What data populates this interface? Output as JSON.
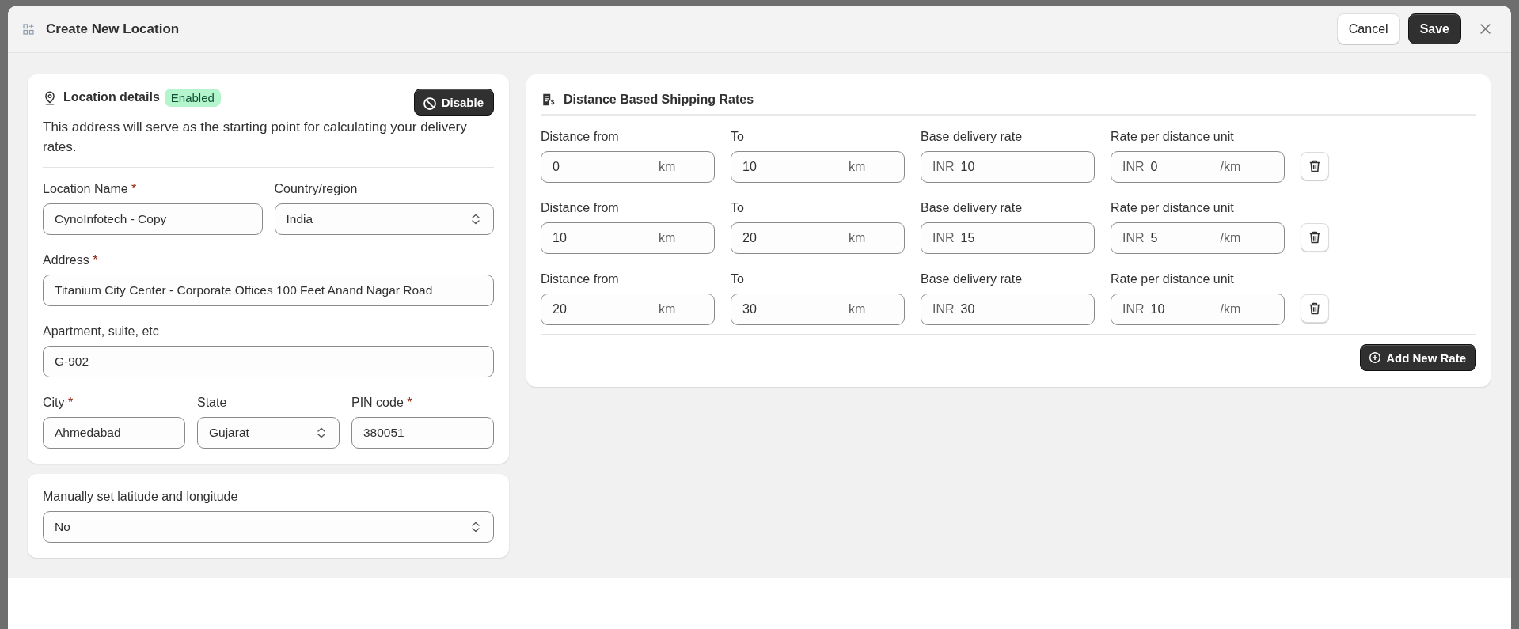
{
  "dialog": {
    "title": "Create New Location",
    "buttons": [
      {
        "label": "Cancel",
        "kind": "secondary"
      },
      {
        "label": "Save",
        "kind": "primary"
      }
    ]
  },
  "location_card": {
    "title": "Location details",
    "status_badge": "Enabled",
    "action_button": "Disable",
    "description": "This address will serve as the starting point for calculating your delivery rates.",
    "rows": [
      [
        {
          "label": "Location Name",
          "required_mark": "*",
          "value": "CynoInfotech - Copy",
          "kind": "text"
        },
        {
          "label": "Country/region",
          "value": "India",
          "kind": "select"
        }
      ],
      [
        {
          "label": "Address",
          "required_mark": "*",
          "value": "Titanium City Center - Corporate Offices 100 Feet Anand Nagar Road",
          "kind": "text"
        }
      ],
      [
        {
          "label": "Apartment, suite, etc",
          "value": "G-902",
          "kind": "text"
        }
      ],
      [
        {
          "label": "City",
          "required_mark": "*",
          "value": "Ahmedabad",
          "kind": "text"
        },
        {
          "label": "State",
          "value": "Gujarat",
          "kind": "select"
        },
        {
          "label": "PIN code",
          "required_mark": "*",
          "value": "380051",
          "kind": "text"
        }
      ]
    ]
  },
  "coordinates_card": {
    "label": "Manually set latitude and longitude",
    "value": "No",
    "kind": "select"
  },
  "shipping_card": {
    "title": "Distance Based Shipping Rates",
    "add_button": "Add New Rate",
    "rates": [
      {
        "fields": [
          {
            "label": "Distance from",
            "value": "0",
            "suffix": "km"
          },
          {
            "label": "To",
            "value": "10",
            "suffix": "km"
          },
          {
            "label": "Base delivery rate",
            "prefix": "INR",
            "value": "10"
          },
          {
            "label": "Rate per distance unit",
            "prefix": "INR",
            "value": "0",
            "suffix": "/km"
          }
        ]
      },
      {
        "fields": [
          {
            "label": "Distance from",
            "value": "10",
            "suffix": "km"
          },
          {
            "label": "To",
            "value": "20",
            "suffix": "km"
          },
          {
            "label": "Base delivery rate",
            "prefix": "INR",
            "value": "15"
          },
          {
            "label": "Rate per distance unit",
            "prefix": "INR",
            "value": "5",
            "suffix": "/km"
          }
        ]
      },
      {
        "fields": [
          {
            "label": "Distance from",
            "value": "20",
            "suffix": "km"
          },
          {
            "label": "To",
            "value": "30",
            "suffix": "km"
          },
          {
            "label": "Base delivery rate",
            "prefix": "INR",
            "value": "30"
          },
          {
            "label": "Rate per distance unit",
            "prefix": "INR",
            "value": "10",
            "suffix": "/km"
          }
        ]
      }
    ]
  }
}
